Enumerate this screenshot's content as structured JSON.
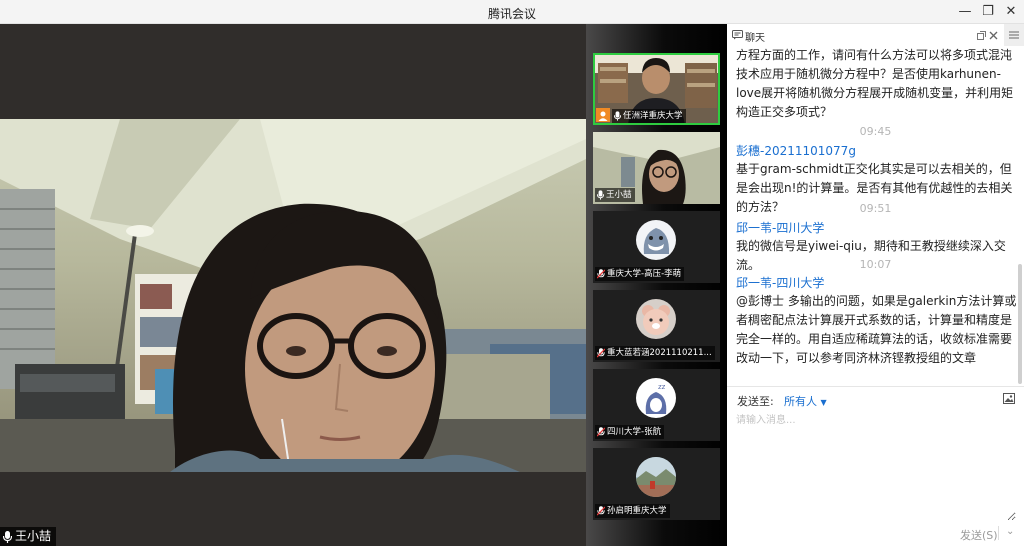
{
  "window": {
    "title": "腾讯会议",
    "minimize_glyph": "—",
    "restore_glyph": "❐",
    "close_glyph": "✕"
  },
  "main_speaker": {
    "name": "王小喆"
  },
  "participants": [
    {
      "name": "任洲洋重庆大学",
      "mic": "on",
      "host": true,
      "video": true,
      "active": true
    },
    {
      "name": "王小喆",
      "mic": "on",
      "video": true
    },
    {
      "name": "重庆大学-高压-李萌",
      "mic": "muted",
      "video": false
    },
    {
      "name": "重大蓝若涵2021110211...",
      "mic": "muted",
      "video": false
    },
    {
      "name": "四川大学-张航",
      "mic": "muted",
      "video": false
    },
    {
      "name": "孙启明重庆大学",
      "mic": "muted",
      "video": false
    }
  ],
  "chat": {
    "title": "聊天",
    "messages": [
      {
        "text": "方程方面的工作，请问有什么方法可以将多项式混沌技术应用于随机微分方程中？是否使用karhunen-love展开将随机微分方程展开成随机变量，并利用矩构造正交多项式？"
      },
      {
        "time": "09:45"
      },
      {
        "sender": "彭穗-20211101077g",
        "text": "基于gram-schmidt正交化其实是可以去相关的，但是会出现n!的计算量。是否有其他有优越性的去相关的方法？"
      },
      {
        "time": "09:51"
      },
      {
        "sender": "邱一苇-四川大学",
        "text": "我的微信号是yiwei-qiu，期待和王教授继续深入交流。"
      },
      {
        "time": "10:07"
      },
      {
        "sender": "邱一苇-四川大学",
        "text": "@彭博士 多输出的问题，如果是galerkin方法计算或者稠密配点法计算展开式系数的话，计算量和精度是完全一样的。用自适应稀疏算法的话，收敛标准需要改动一下，可以参考同济林济铿教授组的文章"
      }
    ],
    "send_to_label": "发送至:",
    "recipient": "所有人",
    "input_placeholder": "请输入消息...",
    "send_label": "发送(S)"
  },
  "colors": {
    "accent": "#1a6fd0",
    "active_border": "#2ecc40",
    "host_badge": "#f08a24",
    "muted_mic": "#e23b3b"
  }
}
